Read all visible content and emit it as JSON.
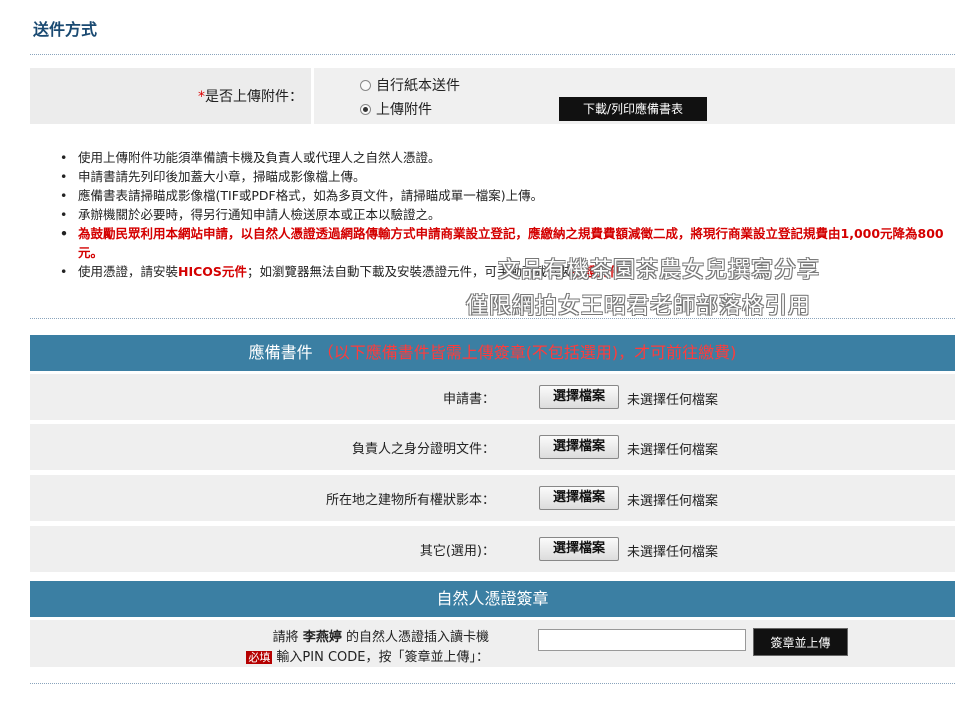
{
  "section_title": "送件方式",
  "upload": {
    "required_mark": "*",
    "label": "是否上傳附件：",
    "options": [
      {
        "label": "自行紙本送件",
        "selected": false
      },
      {
        "label": "上傳附件",
        "selected": true
      }
    ],
    "download_button": "下載/列印應備書表"
  },
  "notes": [
    "使用上傳附件功能須準備讀卡機及負責人或代理人之自然人憑證。",
    "申請書請先列印後加蓋大小章，掃瞄成影像檔上傳。",
    "應備書表請掃瞄成影像檔(TIF或PDF格式，如為多頁文件，請掃瞄成單一檔案)上傳。",
    "承辦機關於必要時，得另行通知申請人檢送原本或正本以驗證之。",
    "為鼓勵民眾利用本網站申請，以自然人憑證透過網路傳輸方式申請商業設立登記，應繳納之規費費額減徵二成，將現行商業設立登記規費由1,000元降為800元。"
  ],
  "hicos_note": {
    "prefix": "使用憑證，請安裝",
    "link1": "HICOS元件",
    "middle": "；如瀏覽器無法自動下載及安裝憑證元件，可手動下載安裝",
    "link2": "憑證元件",
    "suffix": "。"
  },
  "watermark": {
    "line1": "文品有機茶園茶農女兒撰寫分享",
    "line2": "僅限網拍女王昭君老師部落格引用"
  },
  "required_docs": {
    "header": "應備書件",
    "header_note": "（以下應備書件皆需上傳簽章(不包括選用)，才可前往繳費)",
    "choose_label": "選擇檔案",
    "no_file": "未選擇任何檔案",
    "items": [
      {
        "label": "申請書："
      },
      {
        "label": "負責人之身分證明文件："
      },
      {
        "label": "所在地之建物所有權狀影本："
      },
      {
        "label": "其它(選用)："
      }
    ]
  },
  "signature": {
    "header": "自然人憑證簽章",
    "line1_prefix": "請將",
    "name": "李燕婷",
    "line1_suffix": "的自然人憑證插入讀卡機",
    "required_badge": "必填",
    "line2": "輸入PIN CODE，按「簽章並上傳」：",
    "pin_value": "",
    "button": "簽章並上傳"
  }
}
